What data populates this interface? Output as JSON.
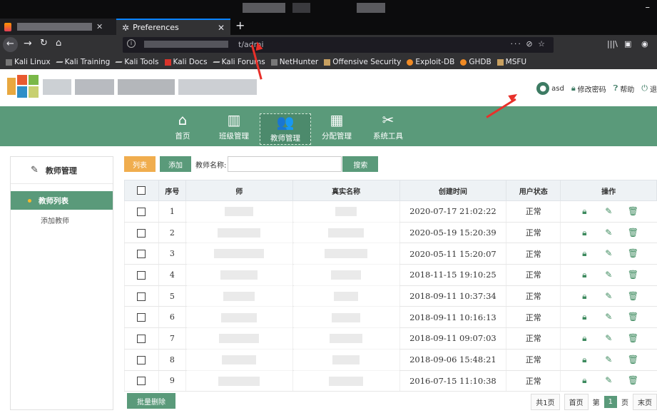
{
  "browser": {
    "tabs": [
      {
        "label": ""
      },
      {
        "label": "Preferences"
      }
    ],
    "url_fragment": "t/admi",
    "url_actions": "··· ⊘ ☆",
    "bookmarks": [
      "Kali Linux",
      "Kali Training",
      "Kali Tools",
      "Kali Docs",
      "Kali Forums",
      "NetHunter",
      "Offensive Security",
      "Exploit-DB",
      "GHDB",
      "MSFU"
    ]
  },
  "header": {
    "user_name": "asd",
    "change_password": "修改密码",
    "help": "帮助",
    "logout": "退"
  },
  "main_nav": [
    {
      "label": "首页",
      "icon": "home-icon",
      "glyph": "⌂"
    },
    {
      "label": "班级管理",
      "icon": "bar-chart-icon",
      "glyph": "▥"
    },
    {
      "label": "教师管理",
      "icon": "users-icon",
      "glyph": "👥"
    },
    {
      "label": "分配管理",
      "icon": "grid-icon",
      "glyph": "▦"
    },
    {
      "label": "系统工具",
      "icon": "tools-icon",
      "glyph": "✂"
    }
  ],
  "sidebar": {
    "title": "教师管理",
    "items": [
      "教师列表",
      "添加教师"
    ]
  },
  "toolbar": {
    "list_label": "列表",
    "add_label": "添加",
    "search_label": "教师名称:",
    "search_value": "",
    "search_button": "搜索"
  },
  "table": {
    "headers": [
      "",
      "序号",
      "师",
      "真实名称",
      "创建时间",
      "用户状态",
      "操作"
    ],
    "rows": [
      {
        "seq": "1",
        "created": "2020-07-17 21:02:22",
        "status": "正常"
      },
      {
        "seq": "2",
        "created": "2020-05-19 15:20:39",
        "status": "正常"
      },
      {
        "seq": "3",
        "created": "2020-05-11 15:20:07",
        "status": "正常"
      },
      {
        "seq": "4",
        "created": "2018-11-15 19:10:25",
        "status": "正常"
      },
      {
        "seq": "5",
        "created": "2018-09-11 10:37:34",
        "status": "正常"
      },
      {
        "seq": "6",
        "created": "2018-09-11 10:16:13",
        "status": "正常"
      },
      {
        "seq": "7",
        "created": "2018-09-11 09:07:03",
        "status": "正常"
      },
      {
        "seq": "8",
        "created": "2018-09-06 15:48:21",
        "status": "正常"
      },
      {
        "seq": "9",
        "created": "2016-07-15 11:10:38",
        "status": "正常"
      }
    ]
  },
  "footer": {
    "bulk_delete": "批量删除",
    "total_pages": "共1页",
    "first_page": "首页",
    "page_prefix": "第",
    "current_page": "1",
    "page_suffix": "页",
    "last_page": "末页"
  },
  "colors": {
    "brand_green": "#5a9a7a",
    "orange": "#f0ad4e",
    "annotation_red": "#e8302a"
  }
}
